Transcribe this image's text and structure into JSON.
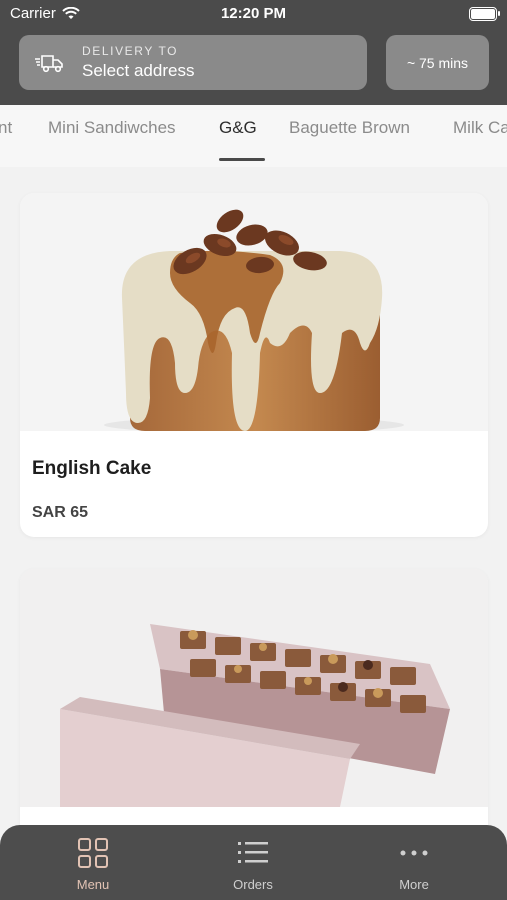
{
  "status": {
    "carrier": "Carrier",
    "time": "12:20 PM"
  },
  "delivery": {
    "label": "DELIVERY TO",
    "address": "Select address"
  },
  "eta": "~ 75 mins",
  "tabs": [
    {
      "label": "nt"
    },
    {
      "label": "Mini Sandiwches"
    },
    {
      "label": "G&G"
    },
    {
      "label": "Baguette Brown"
    },
    {
      "label": "Milk Ca"
    }
  ],
  "active_tab": "G&G",
  "products": [
    {
      "name": "English Cake",
      "price": "SAR 65"
    }
  ],
  "bottom_nav": {
    "menu": "Menu",
    "orders": "Orders",
    "more": "More"
  },
  "colors": {
    "header_bg": "#4b4b4b",
    "pill_bg": "#8a8a8a",
    "nav_bg": "#4d4d4d",
    "accent": "#e2c3b4"
  }
}
